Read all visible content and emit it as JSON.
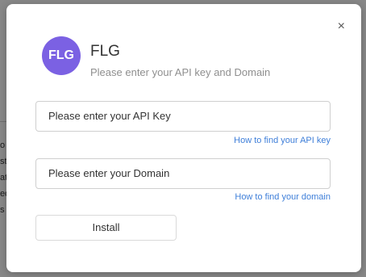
{
  "background": {
    "fragments": [
      "o",
      "st",
      "at",
      "ed",
      "s"
    ]
  },
  "dialog": {
    "close_glyph": "×",
    "logo_text": "FLG",
    "title": "FLG",
    "subtitle": "Please enter your API key and Domain",
    "api_key_field": {
      "placeholder": "Please enter your API Key",
      "value": ""
    },
    "api_key_help": "How to find your API key",
    "domain_field": {
      "placeholder": "Please enter your Domain",
      "value": ""
    },
    "domain_help": "How to find your domain",
    "install_label": "Install"
  },
  "colors": {
    "brand": "#7b61e3",
    "link": "#3f7fd9"
  }
}
